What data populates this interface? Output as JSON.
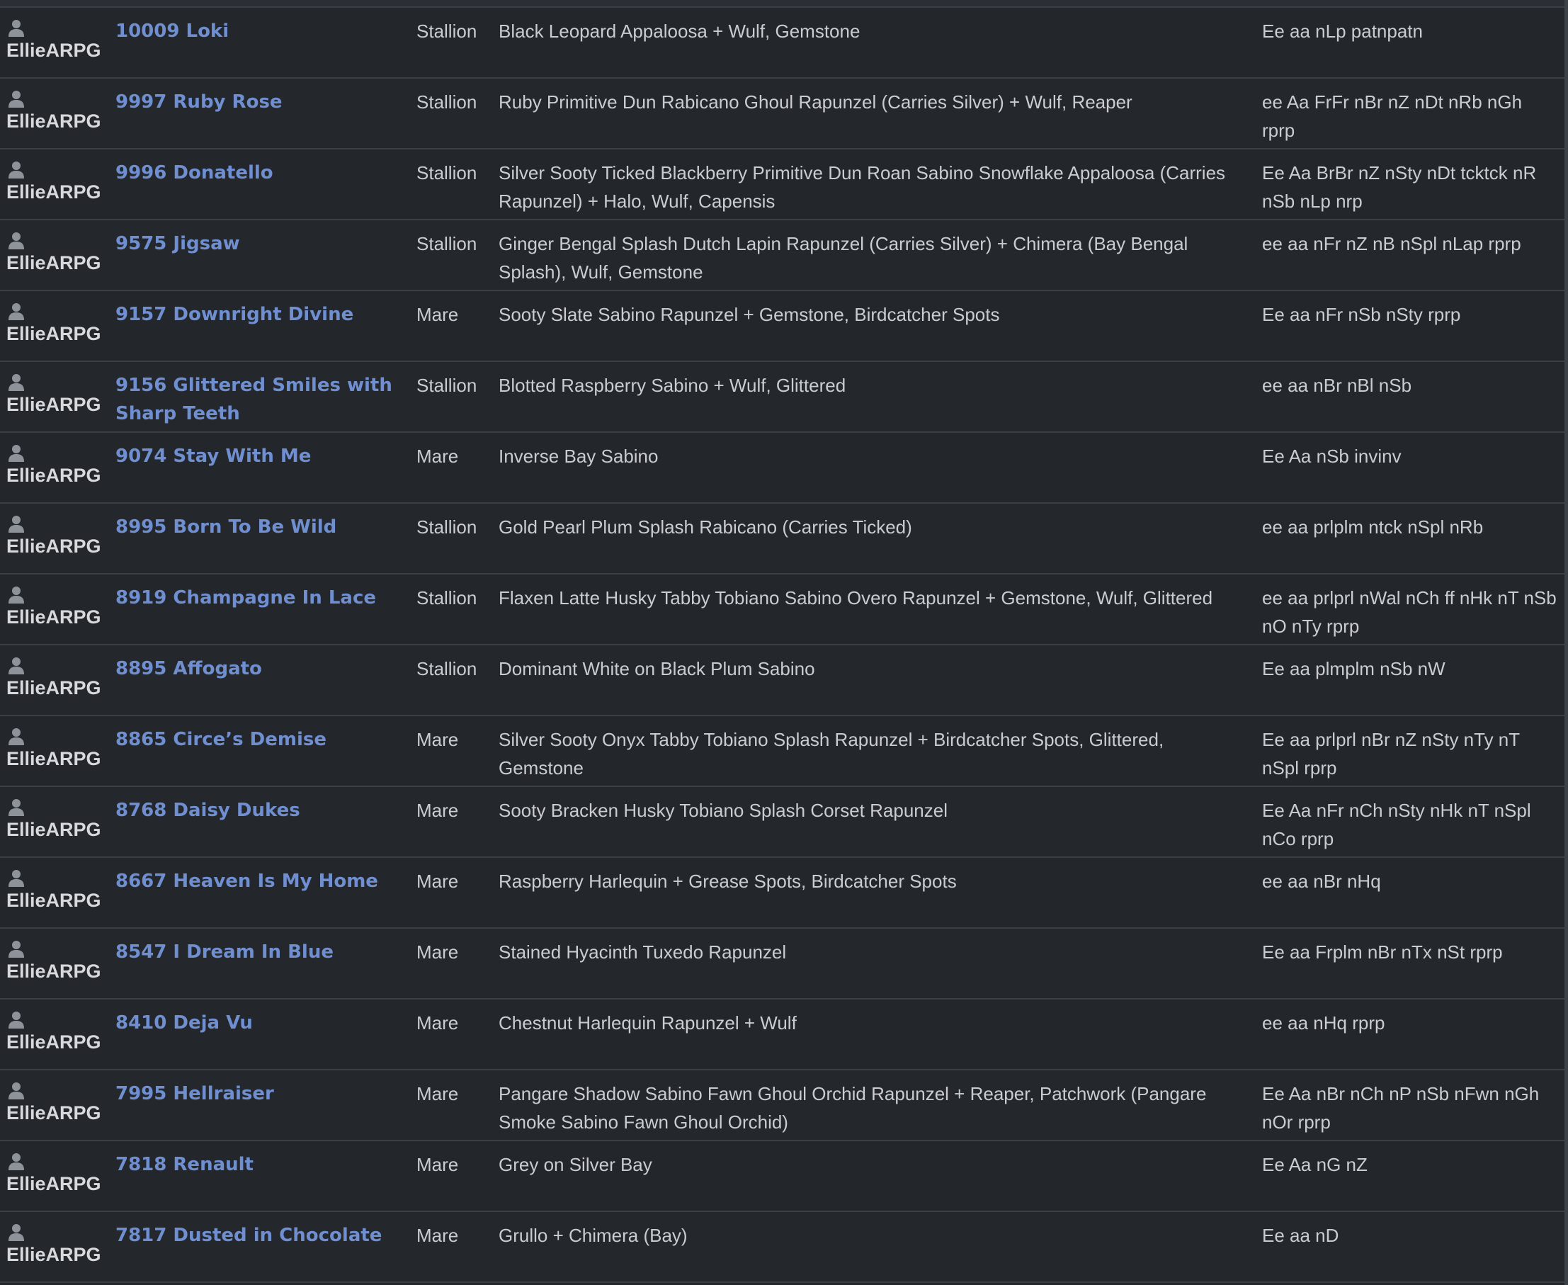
{
  "rows": [
    {
      "owner": "EllieARPG",
      "name": "10009 Loki",
      "sex": "Stallion",
      "description": "Black Leopard Appaloosa + Wulf, Gemstone",
      "genotype": "Ee aa nLp patnpatn"
    },
    {
      "owner": "EllieARPG",
      "name": "9997 Ruby Rose",
      "sex": "Stallion",
      "description": "Ruby Primitive Dun Rabicano Ghoul Rapunzel (Carries Silver) + Wulf, Reaper",
      "genotype": "ee Aa FrFr nBr nZ nDt nRb nGh rprp"
    },
    {
      "owner": "EllieARPG",
      "name": "9996 Donatello",
      "sex": "Stallion",
      "description": "Silver Sooty Ticked Blackberry Primitive Dun Roan Sabino Snowflake Appaloosa (Carries Rapunzel) + Halo, Wulf, Capensis",
      "genotype": "Ee Aa BrBr nZ nSty nDt tcktck nR nSb nLp nrp"
    },
    {
      "owner": "EllieARPG",
      "name": "9575 Jigsaw",
      "sex": "Stallion",
      "description": "Ginger Bengal Splash Dutch Lapin Rapunzel (Carries Silver) + Chimera (Bay Bengal Splash), Wulf, Gemstone",
      "genotype": "ee aa nFr nZ nB nSpl nLap rprp"
    },
    {
      "owner": "EllieARPG",
      "name": "9157 Downright Divine",
      "sex": "Mare",
      "description": "Sooty Slate Sabino Rapunzel + Gemstone, Birdcatcher Spots",
      "genotype": "Ee aa nFr nSb nSty rprp"
    },
    {
      "owner": "EllieARPG",
      "name": "9156 Glittered Smiles with Sharp Teeth",
      "sex": "Stallion",
      "description": "Blotted Raspberry Sabino + Wulf, Glittered",
      "genotype": "ee aa nBr nBl nSb"
    },
    {
      "owner": "EllieARPG",
      "name": "9074 Stay With Me",
      "sex": "Mare",
      "description": "Inverse Bay Sabino",
      "genotype": "Ee Aa nSb invinv"
    },
    {
      "owner": "EllieARPG",
      "name": "8995 Born To Be Wild",
      "sex": "Stallion",
      "description": "Gold Pearl Plum Splash Rabicano (Carries Ticked)",
      "genotype": "ee aa prlplm ntck nSpl nRb"
    },
    {
      "owner": "EllieARPG",
      "name": "8919 Champagne In Lace",
      "sex": "Stallion",
      "description": "Flaxen Latte Husky Tabby Tobiano Sabino Overo Rapunzel + Gemstone, Wulf, Glittered",
      "genotype": "ee aa prlprl nWal nCh ff nHk nT nSb nO nTy rprp"
    },
    {
      "owner": "EllieARPG",
      "name": "8895 Affogato",
      "sex": "Stallion",
      "description": "Dominant White on Black Plum Sabino",
      "genotype": "Ee aa plmplm nSb nW"
    },
    {
      "owner": "EllieARPG",
      "name": "8865 Circe’s Demise",
      "sex": "Mare",
      "description": "Silver Sooty Onyx Tabby Tobiano Splash Rapunzel + Birdcatcher Spots, Glittered, Gemstone",
      "genotype": "Ee aa prlprl nBr nZ nSty nTy nT nSpl rprp"
    },
    {
      "owner": "EllieARPG",
      "name": "8768 Daisy Dukes",
      "sex": "Mare",
      "description": "Sooty Bracken Husky Tobiano Splash Corset Rapunzel",
      "genotype": "Ee Aa nFr nCh nSty nHk nT nSpl nCo rprp"
    },
    {
      "owner": "EllieARPG",
      "name": "8667 Heaven Is My Home",
      "sex": "Mare",
      "description": "Raspberry Harlequin + Grease Spots, Birdcatcher Spots",
      "genotype": "ee aa nBr nHq"
    },
    {
      "owner": "EllieARPG",
      "name": "8547 I Dream In Blue",
      "sex": "Mare",
      "description": "Stained Hyacinth Tuxedo Rapunzel",
      "genotype": "Ee aa Frplm nBr nTx nSt rprp"
    },
    {
      "owner": "EllieARPG",
      "name": "8410 Deja Vu",
      "sex": "Mare",
      "description": "Chestnut Harlequin Rapunzel + Wulf",
      "genotype": "ee aa nHq rprp"
    },
    {
      "owner": "EllieARPG",
      "name": "7995 Hellraiser",
      "sex": "Mare",
      "description": "Pangare Shadow Sabino Fawn Ghoul Orchid Rapunzel + Reaper, Patchwork (Pangare Smoke Sabino Fawn Ghoul Orchid)",
      "genotype": "Ee Aa nBr nCh nP nSb nFwn nGh nOr rprp"
    },
    {
      "owner": "EllieARPG",
      "name": "7818 Renault",
      "sex": "Mare",
      "description": "Grey on Silver Bay",
      "genotype": "Ee Aa nG nZ"
    },
    {
      "owner": "EllieARPG",
      "name": "7817 Dusted in Chocolate",
      "sex": "Mare",
      "description": "Grullo + Chimera (Bay)",
      "genotype": "Ee aa nD"
    }
  ],
  "colors": {
    "background": "#23262b",
    "link": "#6f8fd1",
    "text": "#c9ccd1",
    "owner_text": "#d7d9dc",
    "divider": "#3a3f46",
    "icon": "#8e939a"
  },
  "icons": {
    "owner": "user-icon"
  }
}
